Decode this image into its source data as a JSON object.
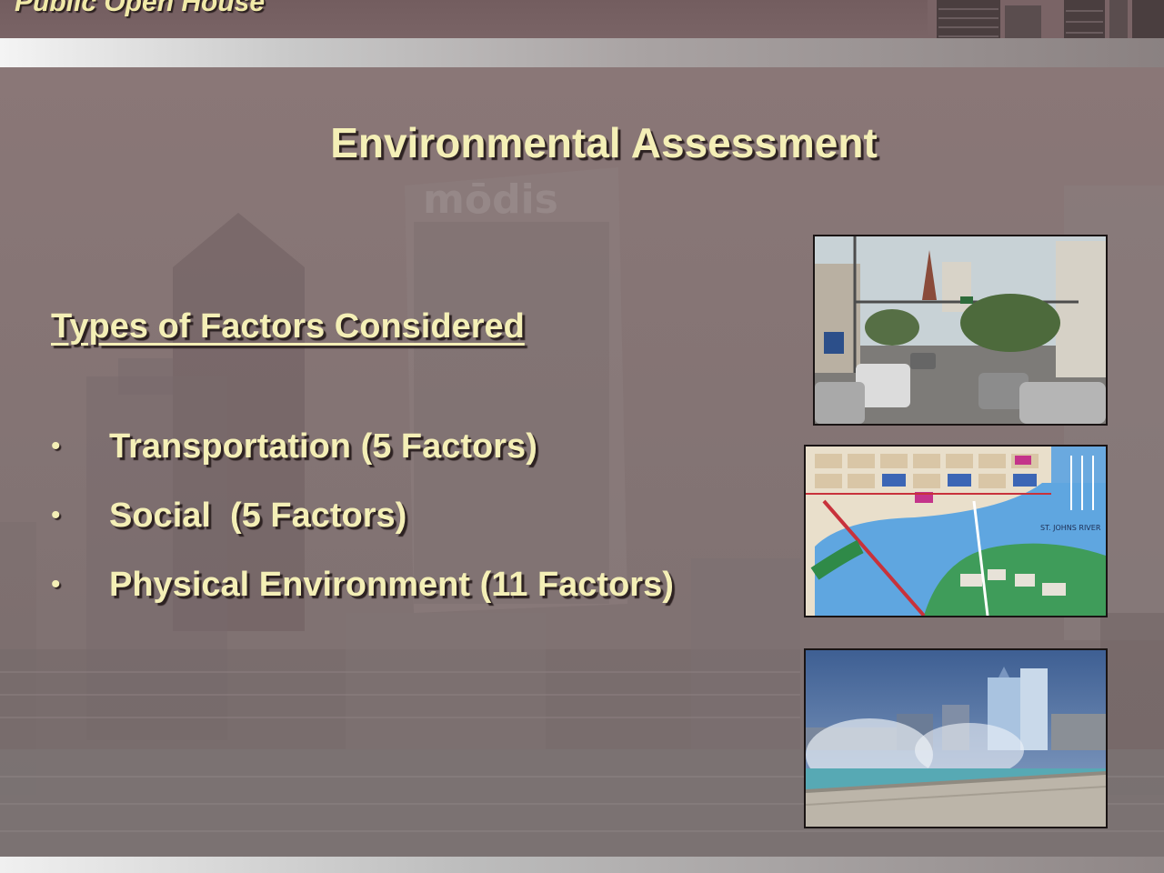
{
  "header": {
    "title": "Public Open House"
  },
  "slide": {
    "title": "Environmental Assessment",
    "section_heading": "Types of Factors Considered",
    "bullets": [
      {
        "marker": "•",
        "text": "Transportation (5 Factors)"
      },
      {
        "marker": "•",
        "text": "Social  (5 Factors)"
      },
      {
        "marker": "•",
        "text": "Physical Environment (11 Factors)"
      }
    ]
  },
  "watermark": {
    "building_sign": "mōdis"
  },
  "photos": {
    "street": {
      "icon": "street-scene-photo"
    },
    "map": {
      "icon": "downtown-map-image",
      "river_label": "ST. JOHNS RIVER"
    },
    "fountain": {
      "icon": "fountain-skyline-photo"
    }
  },
  "colors": {
    "background": "#7e6a6a",
    "text": "#f4efb6",
    "shadow": "#2d2222"
  }
}
